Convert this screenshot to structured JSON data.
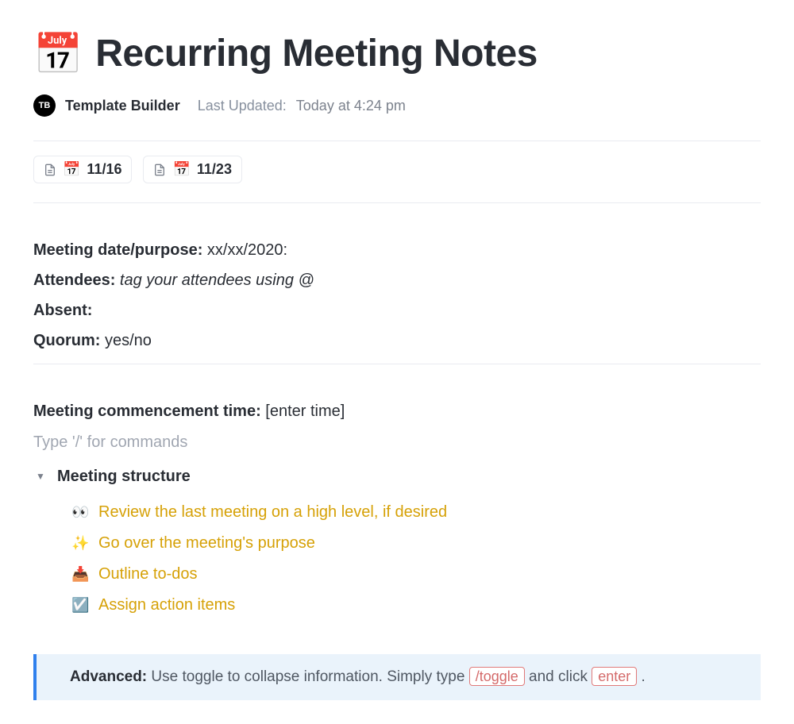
{
  "header": {
    "icon": "📅",
    "title": "Recurring Meeting Notes",
    "avatar_initials": "TB",
    "author": "Template Builder",
    "updated_label": "Last Updated:",
    "updated_value": "Today at 4:24 pm"
  },
  "tabs": [
    {
      "emoji": "📅",
      "label": "11/16"
    },
    {
      "emoji": "📅",
      "label": "11/23"
    }
  ],
  "info": {
    "date_label": "Meeting date/purpose:",
    "date_value": "xx/xx/2020:",
    "attendees_label": "Attendees:",
    "attendees_value": "tag your attendees using @",
    "absent_label": "Absent:",
    "absent_value": "",
    "quorum_label": "Quorum:",
    "quorum_value": "yes/no"
  },
  "commence": {
    "label": "Meeting commencement time:",
    "value": "[enter time]"
  },
  "placeholder": "Type '/' for commands",
  "structure": {
    "title": "Meeting structure",
    "items": [
      {
        "emoji": "👀",
        "text": "Review the last meeting on a high level, if desired"
      },
      {
        "emoji": "✨",
        "text": "Go over the meeting's purpose"
      },
      {
        "emoji": "📥",
        "text": "Outline to-dos"
      },
      {
        "emoji": "☑️",
        "text": "Assign action items"
      }
    ]
  },
  "callout": {
    "strong": "Advanced:",
    "text1": " Use toggle to collapse information. Simply type ",
    "kbd1": "/toggle",
    "text2": " and click ",
    "kbd2": "enter",
    "text3": " ."
  }
}
